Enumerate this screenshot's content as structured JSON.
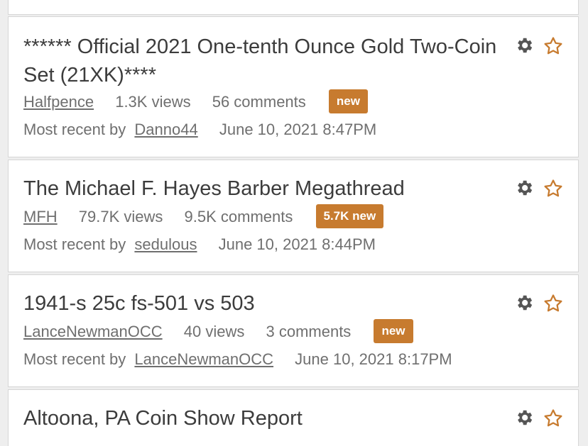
{
  "threads": [
    {
      "title": "****** Official 2021 One-tenth Ounce Gold Two-Coin Set (21XK)****",
      "author": "Halfpence",
      "views": "1.3K views",
      "comments": "56 comments",
      "badge": "new",
      "recent_prefix": "Most recent by",
      "recent_user": "Danno44",
      "date": "June 10, 2021 8:47PM"
    },
    {
      "title": "The Michael F. Hayes Barber Megathread",
      "author": "MFH",
      "views": "79.7K views",
      "comments": "9.5K comments",
      "badge": "5.7K new",
      "recent_prefix": "Most recent by",
      "recent_user": "sedulous",
      "date": "June 10, 2021 8:44PM"
    },
    {
      "title": "1941-s 25c fs-501 vs 503",
      "author": "LanceNewmanOCC",
      "views": "40 views",
      "comments": "3 comments",
      "badge": "new",
      "recent_prefix": "Most recent by",
      "recent_user": "LanceNewmanOCC",
      "date": "June 10, 2021 8:17PM"
    },
    {
      "title": "Altoona, PA Coin Show Report"
    }
  ],
  "colors": {
    "accent": "#c77b2f",
    "icon": "#555555",
    "text": "#3c3c3c"
  },
  "icons": {
    "options": "gear-icon",
    "bookmark": "star-icon"
  }
}
